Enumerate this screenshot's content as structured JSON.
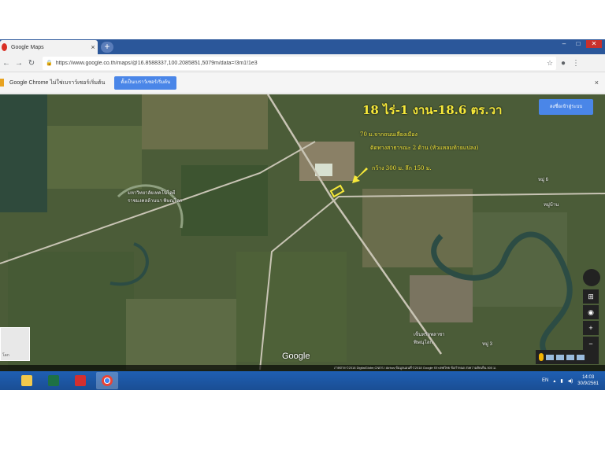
{
  "browser": {
    "tab_title": "Google Maps",
    "tab_close": "×",
    "new_tab": "+",
    "url": "https://www.google.co.th/maps/@16.8588337,100.2085851,5079m/data=!3m1!1e3",
    "infobar_message": "Google Chrome ไม่ใช่เบราว์เซอร์เริ่มต้น",
    "infobar_button": "ตั้งเป็นเบราว์เซอร์เริ่มต้น",
    "infobar_close": "×"
  },
  "map": {
    "headline": "18 ไร่-1 งาน-18.6 ตร.วา",
    "line1": "70 ม.จากถนนเลี่ยงเมือง",
    "line2": "ติดทางสาธารณะ 2 ด้าน (หัวแหลมท้ายแปลง)",
    "line3": "กว้าง 300 ม. ลึก 150 ม.",
    "signin_button": "ลงชื่อเข้าสู่ระบบ",
    "place_university": "มหาวิทยาลัยเทคโนโลยีราชมงคลล้านนา พิษณุโลก",
    "place_moo6": "หมู่ 6",
    "place_village": "หมู่บ้าน",
    "place_moo3": "หมู่ 3",
    "place_center": "เซ็นทรัลพลาซา พิษณุโลก",
    "google_logo": "Google",
    "thumbnail_label": "โลก",
    "footer_text": "ภาพถ่าย ©2018 DigitalGlobe,CNES / Airbus,ข้อมูลแผนที่ ©2018 Google    ประเทศไทย    ข้อกำหนด    ส่งความคิดเห็น    500 ม."
  },
  "taskbar": {
    "lang": "EN",
    "time": "14:03",
    "date": "30/9/2561"
  }
}
